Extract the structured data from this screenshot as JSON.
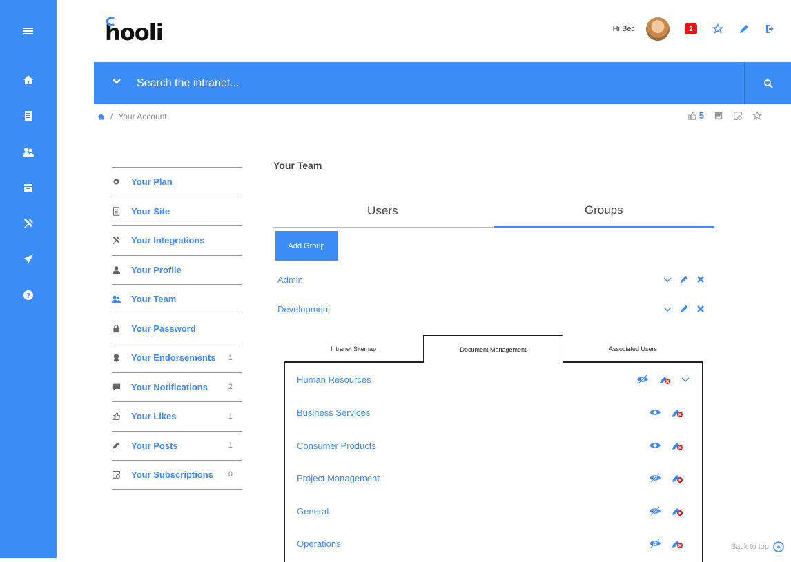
{
  "brand": {
    "logo_text": "hooli"
  },
  "header": {
    "greeting": "Hi Bec",
    "notification_count": "2"
  },
  "search": {
    "placeholder": "Search the intranet..."
  },
  "breadcrumb": {
    "current": "Your Account"
  },
  "page_actions": {
    "likes_count": "5"
  },
  "left_nav": [
    {
      "label": "Your Plan",
      "icon": "gear-icon",
      "count": ""
    },
    {
      "label": "Your Site",
      "icon": "site-icon",
      "count": ""
    },
    {
      "label": "Your Integrations",
      "icon": "tools-icon",
      "count": ""
    },
    {
      "label": "Your Profile",
      "icon": "user-icon",
      "count": ""
    },
    {
      "label": "Your Team",
      "icon": "team-icon",
      "count": ""
    },
    {
      "label": "Your Password",
      "icon": "lock-icon",
      "count": ""
    },
    {
      "label": "Your Endorsements",
      "icon": "award-icon",
      "count": "1"
    },
    {
      "label": "Your Notifications",
      "icon": "message-icon",
      "count": "2"
    },
    {
      "label": "Your Likes",
      "icon": "thumbs-up-icon",
      "count": "1"
    },
    {
      "label": "Your Posts",
      "icon": "pencil-icon",
      "count": "1"
    },
    {
      "label": "Your Subscriptions",
      "icon": "subscribe-icon",
      "count": "0"
    }
  ],
  "team": {
    "title": "Your Team",
    "tabs": [
      "Users",
      "Groups"
    ],
    "active_tab": "Groups",
    "add_group_label": "Add Group",
    "groups": [
      "Admin",
      "Development"
    ]
  },
  "sub_tabs": {
    "labels": [
      "Intranet Sitemap",
      "Document Management",
      "Associated Users"
    ],
    "active": "Document Management"
  },
  "documents": [
    {
      "name": "Human Resources",
      "visible": false,
      "expandable": true
    },
    {
      "name": "Business Services",
      "visible": true,
      "expandable": false
    },
    {
      "name": "Consumer Products",
      "visible": true,
      "expandable": false
    },
    {
      "name": "Project Management",
      "visible": false,
      "expandable": false
    },
    {
      "name": "General",
      "visible": false,
      "expandable": false
    },
    {
      "name": "Operations",
      "visible": false,
      "expandable": false
    }
  ],
  "footer": {
    "back_to_top": "Back to top"
  },
  "colors": {
    "accent": "#3b8cf5",
    "danger": "#e11111"
  }
}
